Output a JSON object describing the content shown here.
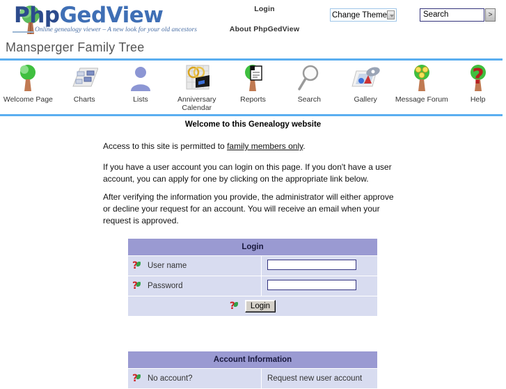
{
  "header": {
    "logo_text_1": "Php",
    "logo_text_2": "GedView",
    "tagline": "Online genealogy viewer – A new look for your old ancestors",
    "links": [
      {
        "label": "Login"
      },
      {
        "label": "About PhpGedView"
      }
    ],
    "theme_select": {
      "selected": "Change Theme",
      "icon": "chevron-down-icon"
    },
    "search": {
      "value": "Search",
      "go_label": ">"
    }
  },
  "page_title": "Mansperger Family Tree",
  "nav": [
    {
      "label": "Welcome Page",
      "icon": "tree-icon"
    },
    {
      "label": "Charts",
      "icon": "org-chart-icon"
    },
    {
      "label": "Lists",
      "icon": "person-icon"
    },
    {
      "label": "Anniversary Calendar",
      "icon": "calendar-rings-icon"
    },
    {
      "label": "Reports",
      "icon": "tree-document-icon"
    },
    {
      "label": "Search",
      "icon": "magnifier-icon"
    },
    {
      "label": "Gallery",
      "icon": "gallery-icon"
    },
    {
      "label": "Message Forum",
      "icon": "tree-faces-icon"
    },
    {
      "label": "Help",
      "icon": "question-mark-icon"
    }
  ],
  "content": {
    "heading": "Welcome to this Genealogy website",
    "paragraph1_before": "Access to this site is permitted to ",
    "paragraph1_link": "family members only",
    "paragraph1_after": ".",
    "paragraph2": "If you have a user account you can login on this page. If you don't have a user account, you can apply for one by clicking on the appropriate link below.",
    "paragraph3": "After verifying the information you provide, the administrator will either approve or decline your request for an account. You will receive an email when your request is approved."
  },
  "login_table": {
    "title": "Login",
    "username_label": "User name",
    "username_value": "",
    "password_label": "Password",
    "password_value": "",
    "submit_label": "Login",
    "help_icon": "help-question-icon"
  },
  "account_table": {
    "title": "Account Information",
    "no_account_label": "No account?",
    "request_link": "Request new user account"
  },
  "colors": {
    "rule_blue": "#5aaef0",
    "table_header": "#9a9ad2",
    "table_cell": "#d8dcf0",
    "logo_blue": "#2c4b8c",
    "title_gray": "#555555"
  }
}
